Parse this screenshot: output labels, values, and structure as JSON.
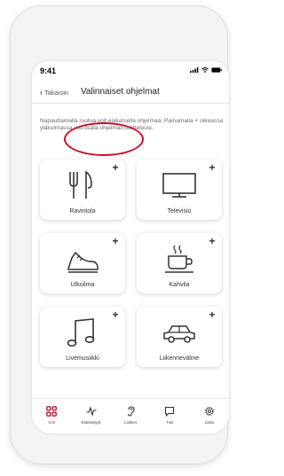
{
  "status": {
    "time": "9:41"
  },
  "header": {
    "back_label": "Takaisin",
    "title": "Valinnaiset ohjelmat"
  },
  "description": "Napauttamalla ruutua voit esikatsella ohjelmaa. Painamalla + oikeassa yläkulmassa voit lisätä ohjelman luetteloosi.",
  "tiles": [
    {
      "label": "Ravintola",
      "icon": "fork-knife-icon",
      "action": "+"
    },
    {
      "label": "Televisio",
      "icon": "television-icon",
      "action": "+"
    },
    {
      "label": "Ulkoilma",
      "icon": "shoe-icon",
      "action": "+"
    },
    {
      "label": "Kahvila",
      "icon": "coffee-cup-icon",
      "action": "+"
    },
    {
      "label": "Livemusiikki",
      "icon": "music-note-icon",
      "action": "+"
    },
    {
      "label": "Liikenneväline",
      "icon": "car-icon",
      "action": "+"
    }
  ],
  "nav": [
    {
      "label": "Koti",
      "icon": "home-grid-icon",
      "active": true
    },
    {
      "label": "Elämäntyyli",
      "icon": "activity-icon",
      "active": false
    },
    {
      "label": "Laitteet",
      "icon": "hearing-aid-icon",
      "active": false
    },
    {
      "label": "Tuki",
      "icon": "chat-icon",
      "active": false
    },
    {
      "label": "Lisää",
      "icon": "gear-icon",
      "active": false
    }
  ],
  "colors": {
    "accent": "#c8102e",
    "text": "#333333",
    "background": "#ffffff"
  }
}
